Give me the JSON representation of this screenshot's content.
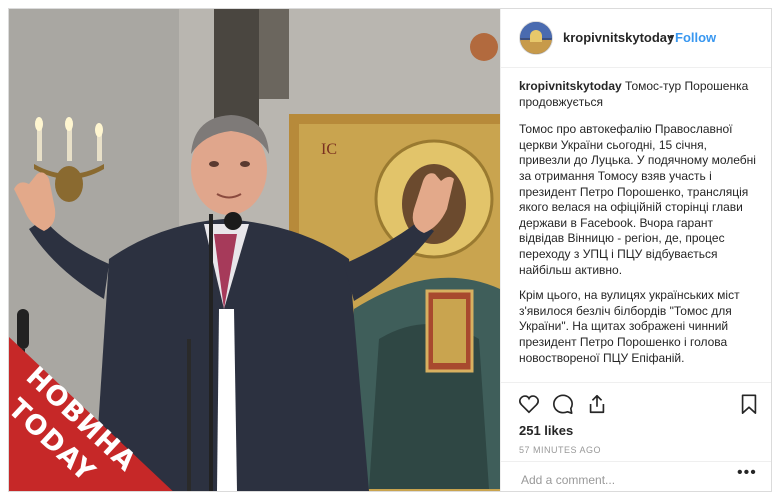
{
  "post": {
    "username": "kropivnitskytoday",
    "dot": "•",
    "follow_label": "Follow",
    "caption_username": "kropivnitskytoday",
    "caption_text": "Томос-тур Порошенка продовжується",
    "paragraph1": "Томос про автокефалію Православної церкви України сьогодні, 15 січня, привезли до Луцька. У подячному молебні за отримання Томосу взяв участь і президент Петро Порошенко, трансляція якого велася на офіційній сторінці глави держави в Facebook. Вчора гарант відвідав Вінницю - регіон, де, процес переходу з УПЦ і ПЦУ відбувається найбільш активно.",
    "paragraph2": "Крім цього, на вулицях українських міст з'явилося безліч білбордів \"Томос для України\". На щитах зображені чинний президент Петро Порошенко і голова новоствореної ПЦУ Епіфаній.",
    "likes": "251 likes",
    "time": "57 MINUTES AGO",
    "comment_placeholder": "Add a comment...",
    "more_label": "•••"
  },
  "badge": {
    "line1": "НОВИНА",
    "line2": "TODAY",
    "color": "#c62828"
  },
  "icons": {
    "like": "heart-icon",
    "comment": "comment-icon",
    "share": "share-icon",
    "save": "bookmark-icon"
  },
  "colors": {
    "link": "#3897f0",
    "text": "#262626",
    "muted": "#999999",
    "border": "#dbdbdb"
  }
}
